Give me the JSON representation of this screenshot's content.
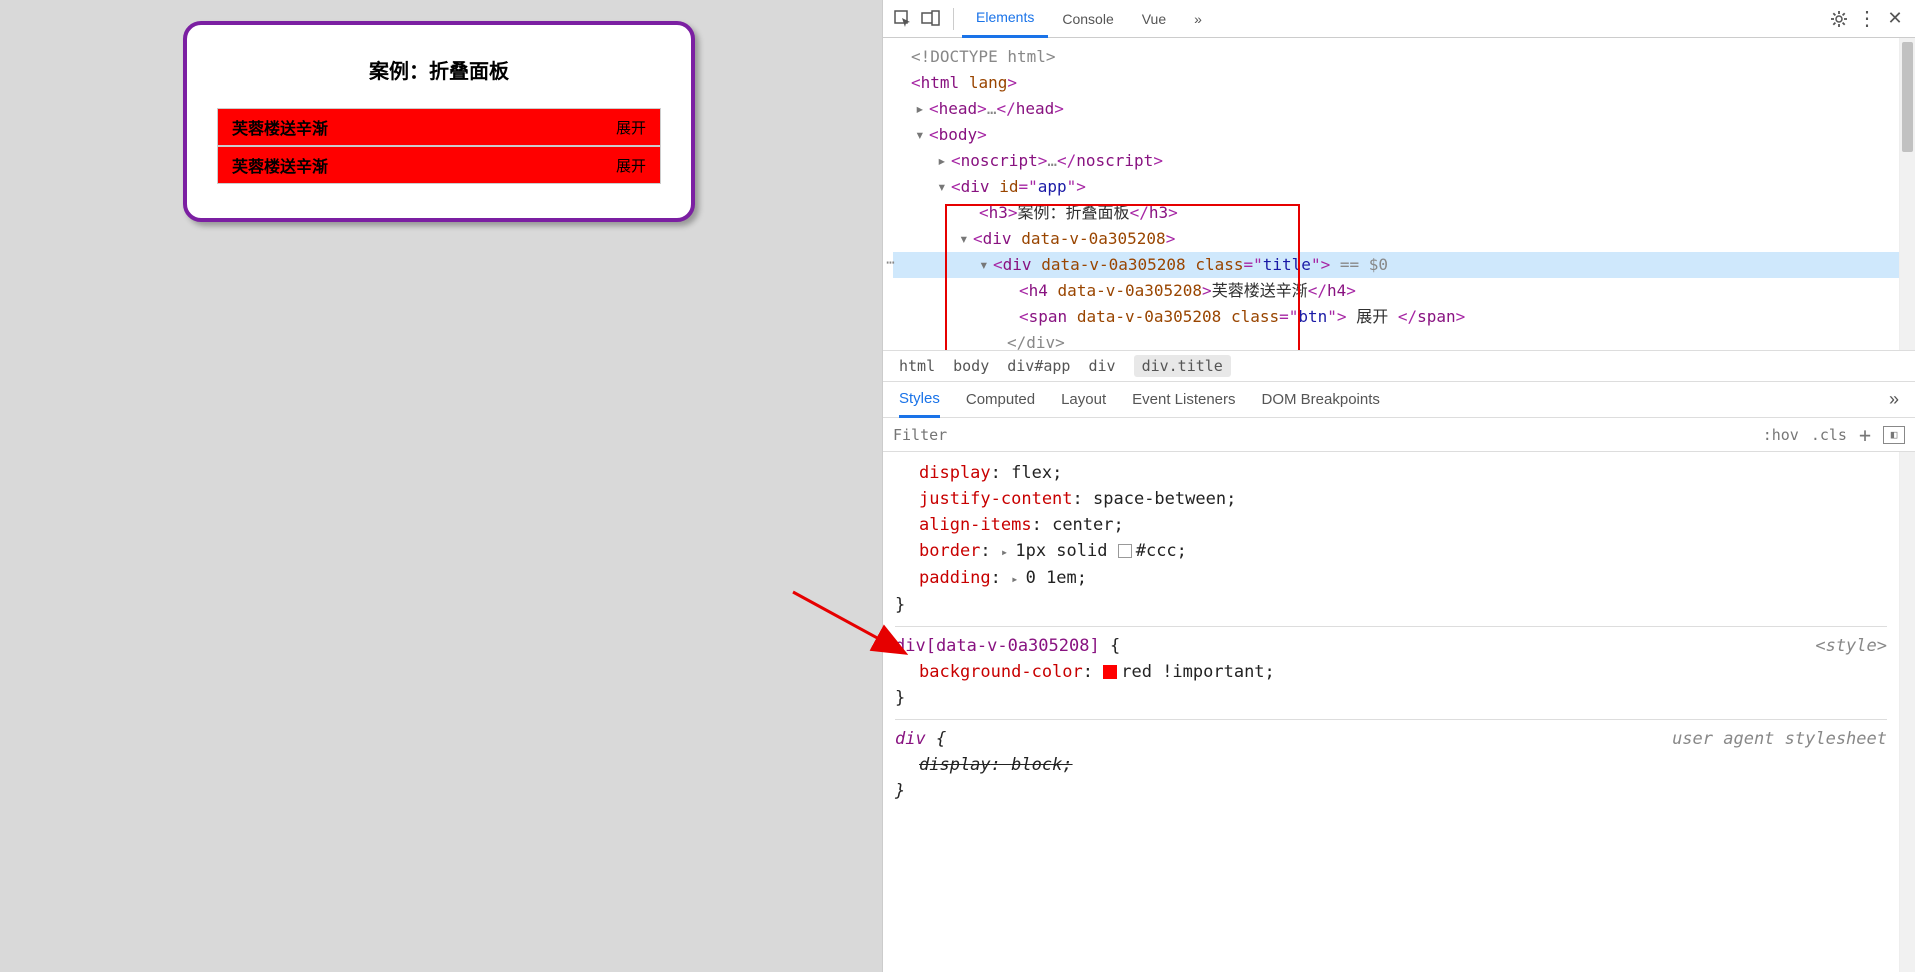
{
  "page": {
    "title": "案例：折叠面板",
    "rows": [
      {
        "title": "芙蓉楼送辛渐",
        "btn": "展开"
      },
      {
        "title": "芙蓉楼送辛渐",
        "btn": "展开"
      }
    ]
  },
  "devtools": {
    "tabs": {
      "elements": "Elements",
      "console": "Console",
      "vue": "Vue",
      "more": "»"
    },
    "tree": {
      "doctype": "<!DOCTYPE html>",
      "html_open": "html",
      "html_attr": "lang",
      "head": "head",
      "head_dots": "…",
      "body": "body",
      "noscript": "noscript",
      "noscript_dots": "…",
      "app_tag": "div",
      "app_attr": "id",
      "app_val": "app",
      "h3_tag": "h3",
      "h3_text": "案例：折叠面板",
      "scoped_tag": "div",
      "scoped_attr": "data-v-0a305208",
      "title_tag": "div",
      "title_class_attr": "class",
      "title_class_val": "title",
      "sel_suffix": " == $0",
      "h4_tag": "h4",
      "h4_text": "芙蓉楼送辛渐",
      "span_tag": "span",
      "span_class_val": "btn",
      "span_text": " 展开 ",
      "closing": "</div>"
    },
    "crumbs": [
      "html",
      "body",
      "div#app",
      "div",
      "div.title"
    ],
    "tabs2": [
      "Styles",
      "Computed",
      "Layout",
      "Event Listeners",
      "DOM Breakpoints"
    ],
    "filter": {
      "placeholder": "Filter",
      "hov": ":hov",
      "cls": ".cls"
    },
    "rules": {
      "r1": {
        "display": "display",
        "display_v": "flex;",
        "jc": "justify-content",
        "jc_v": "space-between;",
        "ai": "align-items",
        "ai_v": "center;",
        "border": "border",
        "border_v": "1px solid ",
        "border_v2": "#ccc;",
        "padding": "padding",
        "padding_v": "0 1em;"
      },
      "r2": {
        "selector": "div[data-v-0a305208]",
        "bg": "background-color",
        "bg_v": "red !important;",
        "src": "<style>"
      },
      "r3": {
        "selector": "div",
        "display": "display",
        "display_v": "block;",
        "src": "user agent stylesheet"
      }
    }
  }
}
